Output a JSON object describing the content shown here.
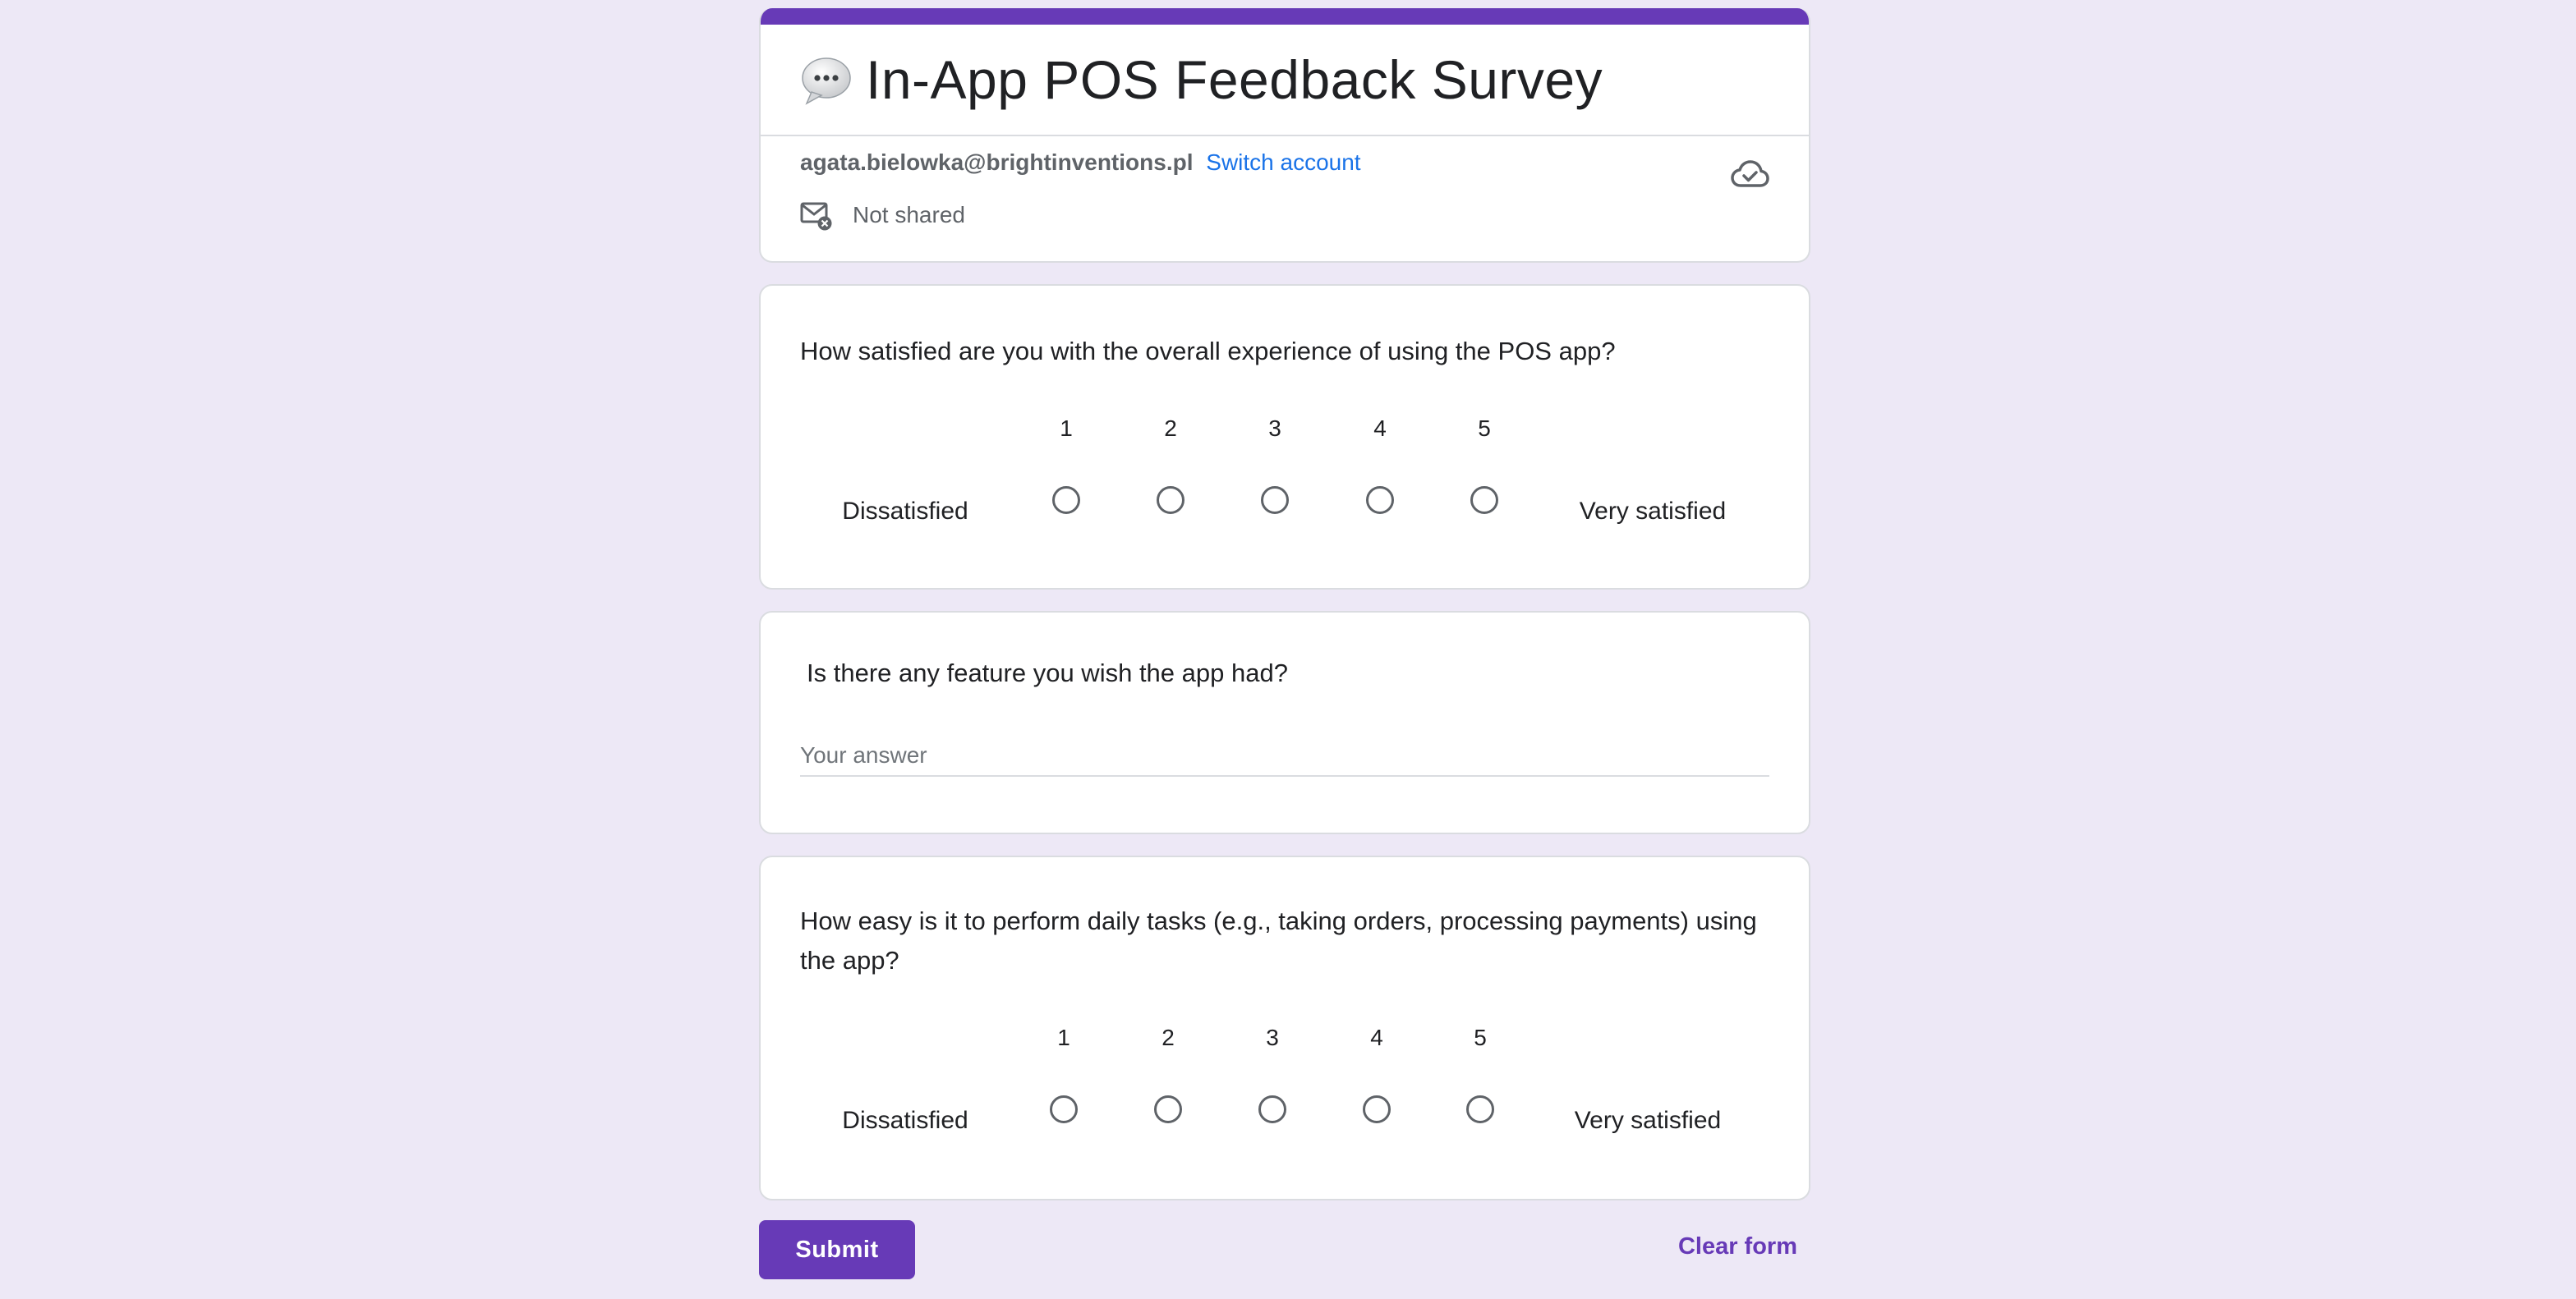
{
  "form": {
    "title": "In-App POS Feedback Survey",
    "title_emoji": "speech-bubble-icon",
    "accent_color": "#673ab7",
    "background_color": "#ede8f6"
  },
  "account": {
    "email": "agata.bielowka@brightinventions.pl",
    "switch_label": "Switch account",
    "share_status": "Not shared",
    "share_icon": "mail-off-icon",
    "save_icon": "cloud-done-icon"
  },
  "questions": [
    {
      "title": "How satisfied are you with the overall experience of using the POS app?",
      "type": "linear-scale",
      "low_label": "Dissatisfied",
      "high_label": "Very satisfied",
      "scale": [
        "1",
        "2",
        "3",
        "4",
        "5"
      ]
    },
    {
      "title": "Is there any feature you wish the app had?",
      "type": "short-answer",
      "placeholder": "Your answer",
      "value": ""
    },
    {
      "title": "How easy is it to perform daily tasks (e.g., taking orders, processing payments) using the app?",
      "type": "linear-scale",
      "low_label": "Dissatisfied",
      "high_label": "Very satisfied",
      "scale": [
        "1",
        "2",
        "3",
        "4",
        "5"
      ]
    }
  ],
  "footer": {
    "submit_label": "Submit",
    "clear_label": "Clear form"
  }
}
